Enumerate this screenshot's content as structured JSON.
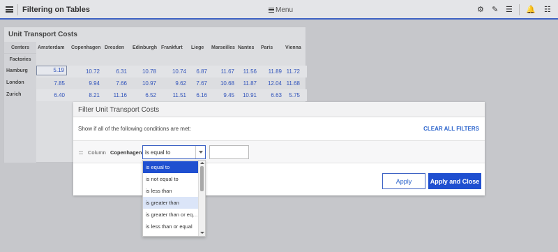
{
  "header": {
    "title": "Filtering on Tables",
    "menu_label": "Menu",
    "icons": [
      "gear-icon",
      "pencil-icon",
      "list-icon",
      "bell-icon",
      "sliders-icon"
    ]
  },
  "table": {
    "title": "Unit Transport Costs",
    "corner_top": "Centers",
    "corner_bottom": "Factories",
    "columns": [
      "Amsterdam",
      "Copenhagen",
      "Dresden",
      "Edinburgh",
      "Frankfurt",
      "Liege",
      "Marseilles",
      "Nantes",
      "Paris",
      "Vienna"
    ],
    "rows": [
      {
        "name": "Hamburg",
        "values": [
          "5.19",
          "10.72",
          "6.31",
          "10.78",
          "10.74",
          "6.87",
          "11.67",
          "11.56",
          "11.89",
          "11.72"
        ]
      },
      {
        "name": "London",
        "values": [
          "7.85",
          "9.94",
          "7.66",
          "10.97",
          "9.62",
          "7.67",
          "10.68",
          "11.87",
          "12.04",
          "11.68"
        ]
      },
      {
        "name": "Zurich",
        "values": [
          "6.40",
          "8.21",
          "11.16",
          "6.52",
          "11.51",
          "6.16",
          "9.45",
          "10.91",
          "6.63",
          "5.75"
        ]
      }
    ]
  },
  "dialog": {
    "title": "Filter Unit Transport Costs",
    "note": "Show if all of the following conditions are met:",
    "clear_all": "CLEAR ALL FILTERS",
    "column_label": "Column",
    "column_name": "Copenhagen",
    "operator_value": "is equal to",
    "value_input": "",
    "apply_label": "Apply",
    "apply_close_label": "Apply and Close"
  },
  "dropdown": {
    "options": [
      "is equal to",
      "is not equal to",
      "is less than",
      "is greater than",
      "is greater than or equal",
      "is less than or equal"
    ],
    "selected_index": 0,
    "hover_index": 3
  },
  "colors": {
    "accent": "#1f4fd0",
    "link": "#2a63cc",
    "cell_text": "#3355bb"
  }
}
